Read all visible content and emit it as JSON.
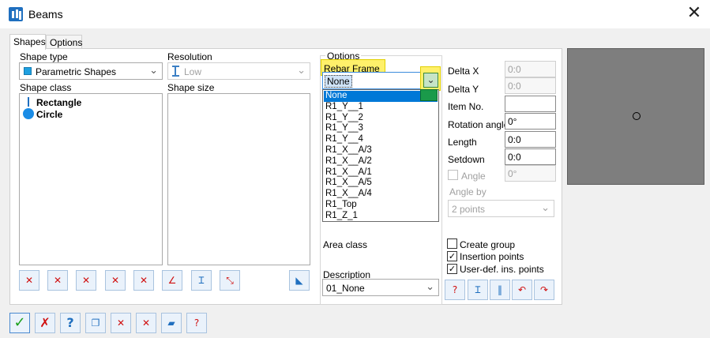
{
  "window": {
    "title": "Beams",
    "close_glyph": "✕"
  },
  "tabs": [
    {
      "label": "Shapes",
      "active": true
    },
    {
      "label": "Options",
      "active": false
    }
  ],
  "shape_type": {
    "label": "Shape type",
    "value": "Parametric Shapes",
    "icon": "square-icon"
  },
  "resolution": {
    "label": "Resolution",
    "value": "Low",
    "icon": "beam-i-icon"
  },
  "shape_class": {
    "label": "Shape class",
    "items": [
      {
        "label": "Rectangle",
        "icon": "line-icon"
      },
      {
        "label": "Circle",
        "icon": "circle-icon"
      }
    ]
  },
  "shape_size": {
    "label": "Shape size"
  },
  "options": {
    "label": "Options",
    "rebar_frame_label": "Rebar Frame",
    "rebar_frame_value": "None",
    "dropdown_items": [
      "None",
      "R1_Y__1",
      "R1_Y__2",
      "R1_Y__3",
      "R1_Y__4",
      "R1_X__A/3",
      "R1_X__A/2",
      "R1_X__A/1",
      "R1_X__A/5",
      "R1_X__A/4",
      "R1_Top",
      "R1_Z_1"
    ],
    "dropdown_selected": "None",
    "area_class_label": "Area class",
    "description_label": "Description",
    "description_value": "01_None"
  },
  "fields": {
    "delta_x": {
      "label": "Delta X",
      "value": "0:0"
    },
    "delta_y": {
      "label": "Delta Y",
      "value": "0:0"
    },
    "item_no": {
      "label": "Item No.",
      "value": ""
    },
    "rotation_angle": {
      "label": "Rotation angle",
      "value": "0°"
    },
    "length": {
      "label": "Length",
      "value": "0:0"
    },
    "setdown": {
      "label": "Setdown",
      "value": "0:0"
    },
    "angle": {
      "label": "Angle",
      "value": "0°",
      "checked": false
    },
    "angle_by": {
      "label": "Angle by",
      "value": "2 points"
    }
  },
  "checkboxes": {
    "create_group": {
      "label": "Create group",
      "checked": false
    },
    "insertion_points": {
      "label": "Insertion points",
      "checked": true
    },
    "user_def_points": {
      "label": "User-def. ins. points",
      "checked": true
    }
  },
  "check_glyph": "✓",
  "help_glyph": "?",
  "colors": {
    "accent": "#0078d7",
    "highlight": "#fff06a",
    "preview_bg": "#7e7e7e"
  }
}
